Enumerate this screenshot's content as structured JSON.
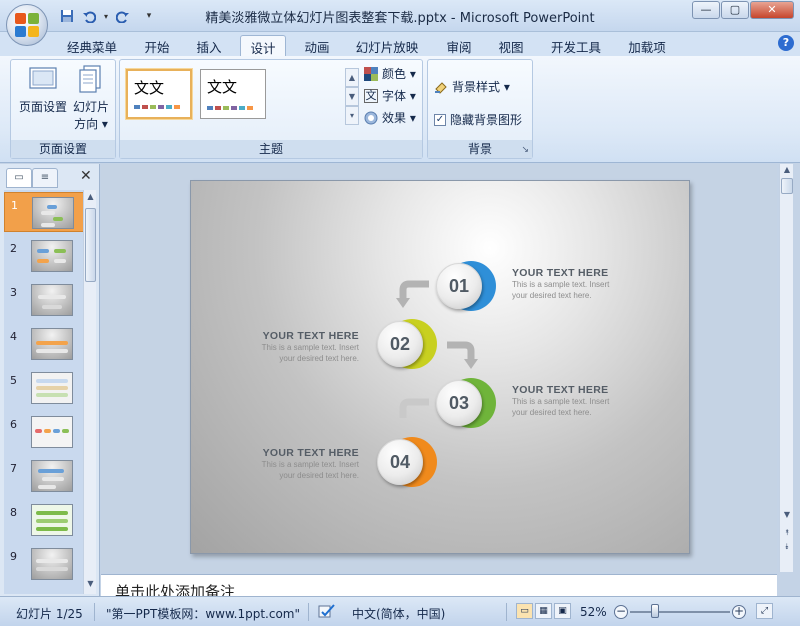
{
  "window": {
    "title": "精美淡雅微立体幻灯片图表整套下载.pptx - Microsoft PowerPoint",
    "minimize": "—",
    "maximize": "▢",
    "close": "✕"
  },
  "quick_access": [
    {
      "name": "save-icon",
      "glyph": "💾"
    },
    {
      "name": "undo-icon",
      "glyph": "↶"
    },
    {
      "name": "redo-icon",
      "glyph": "↻"
    },
    {
      "name": "customize-icon",
      "glyph": "▾"
    }
  ],
  "ribbon_tabs": [
    "经典菜单",
    "开始",
    "插入",
    "设计",
    "动画",
    "幻灯片放映",
    "审阅",
    "视图",
    "开发工具",
    "加载项"
  ],
  "active_tab": "设计",
  "help_label": "?",
  "page_setup_group": {
    "label": "页面设置",
    "page_setup_button": "页面设置",
    "orientation_button_line1": "幻灯片",
    "orientation_button_line2": "方向 ▾"
  },
  "theme_group": {
    "label": "主题",
    "themes": [
      {
        "text": "文文",
        "swatches": [
          "#4f81bd",
          "#c0504d",
          "#9bbb59",
          "#8064a2",
          "#4bacc6",
          "#f79646"
        ]
      },
      {
        "text": "文文",
        "swatches": [
          "#4f81bd",
          "#c0504d",
          "#9bbb59",
          "#8064a2",
          "#4bacc6",
          "#f79646"
        ]
      }
    ],
    "colors_label": "颜色 ▾",
    "fonts_label": "字体 ▾",
    "effects_label": "效果 ▾"
  },
  "background_group": {
    "label": "背景",
    "background_styles": "背景样式 ▾",
    "hide_background_graphics": "隐藏背景图形",
    "hide_background_checked": true
  },
  "slide_panel": {
    "close_label": "✕",
    "slide_numbers": [
      "1",
      "2",
      "3",
      "4",
      "5",
      "6",
      "7",
      "8",
      "9"
    ],
    "selected_slide": "1"
  },
  "slide": {
    "nodes": [
      {
        "number": "01",
        "ring_color": "#2f8fd8"
      },
      {
        "number": "02",
        "ring_color": "#c8d020"
      },
      {
        "number": "03",
        "ring_color": "#6fb43a"
      },
      {
        "number": "04",
        "ring_color": "#f08a1c"
      }
    ],
    "items": [
      {
        "heading": "YOUR TEXT  HERE",
        "body1": "This is a sample  text.  Insert",
        "body2": "your desired  text  here."
      },
      {
        "heading": "YOUR TEXT  HERE",
        "body1": "This is a sample  text.  Insert",
        "body2": "your desired  text  here."
      },
      {
        "heading": "YOUR TEXT  HERE",
        "body1": "This is a sample  text.  Insert",
        "body2": "your desired  text  here."
      },
      {
        "heading": "YOUR TEXT  HERE",
        "body1": "This is a sample  text.  Insert",
        "body2": "your desired  text  here."
      }
    ]
  },
  "notes_placeholder": "单击此处添加备注",
  "status_bar": {
    "slide_indicator": "幻灯片 1/25",
    "theme_name": "\"第一PPT模板网：www.1ppt.com\"",
    "language": "中文(简体，中国)",
    "zoom": "52%",
    "zoom_fraction": 0.52
  }
}
